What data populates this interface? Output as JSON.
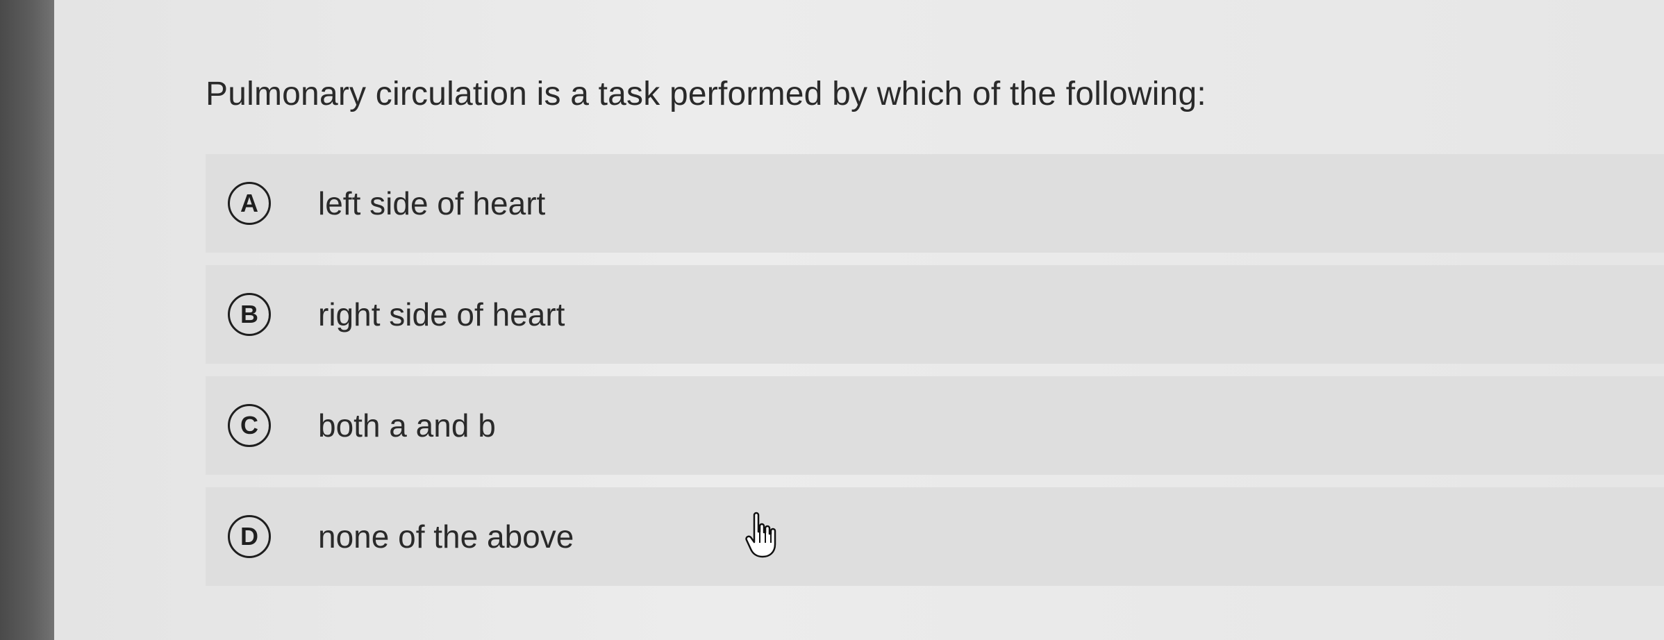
{
  "question": {
    "text": "Pulmonary circulation is a task performed by which of the following:"
  },
  "options": [
    {
      "letter": "A",
      "text": "left side of heart"
    },
    {
      "letter": "B",
      "text": "right side of heart"
    },
    {
      "letter": "C",
      "text": "both a and b"
    },
    {
      "letter": "D",
      "text": "none of the above"
    }
  ],
  "cursor": {
    "icon": "hand-pointer-icon"
  }
}
